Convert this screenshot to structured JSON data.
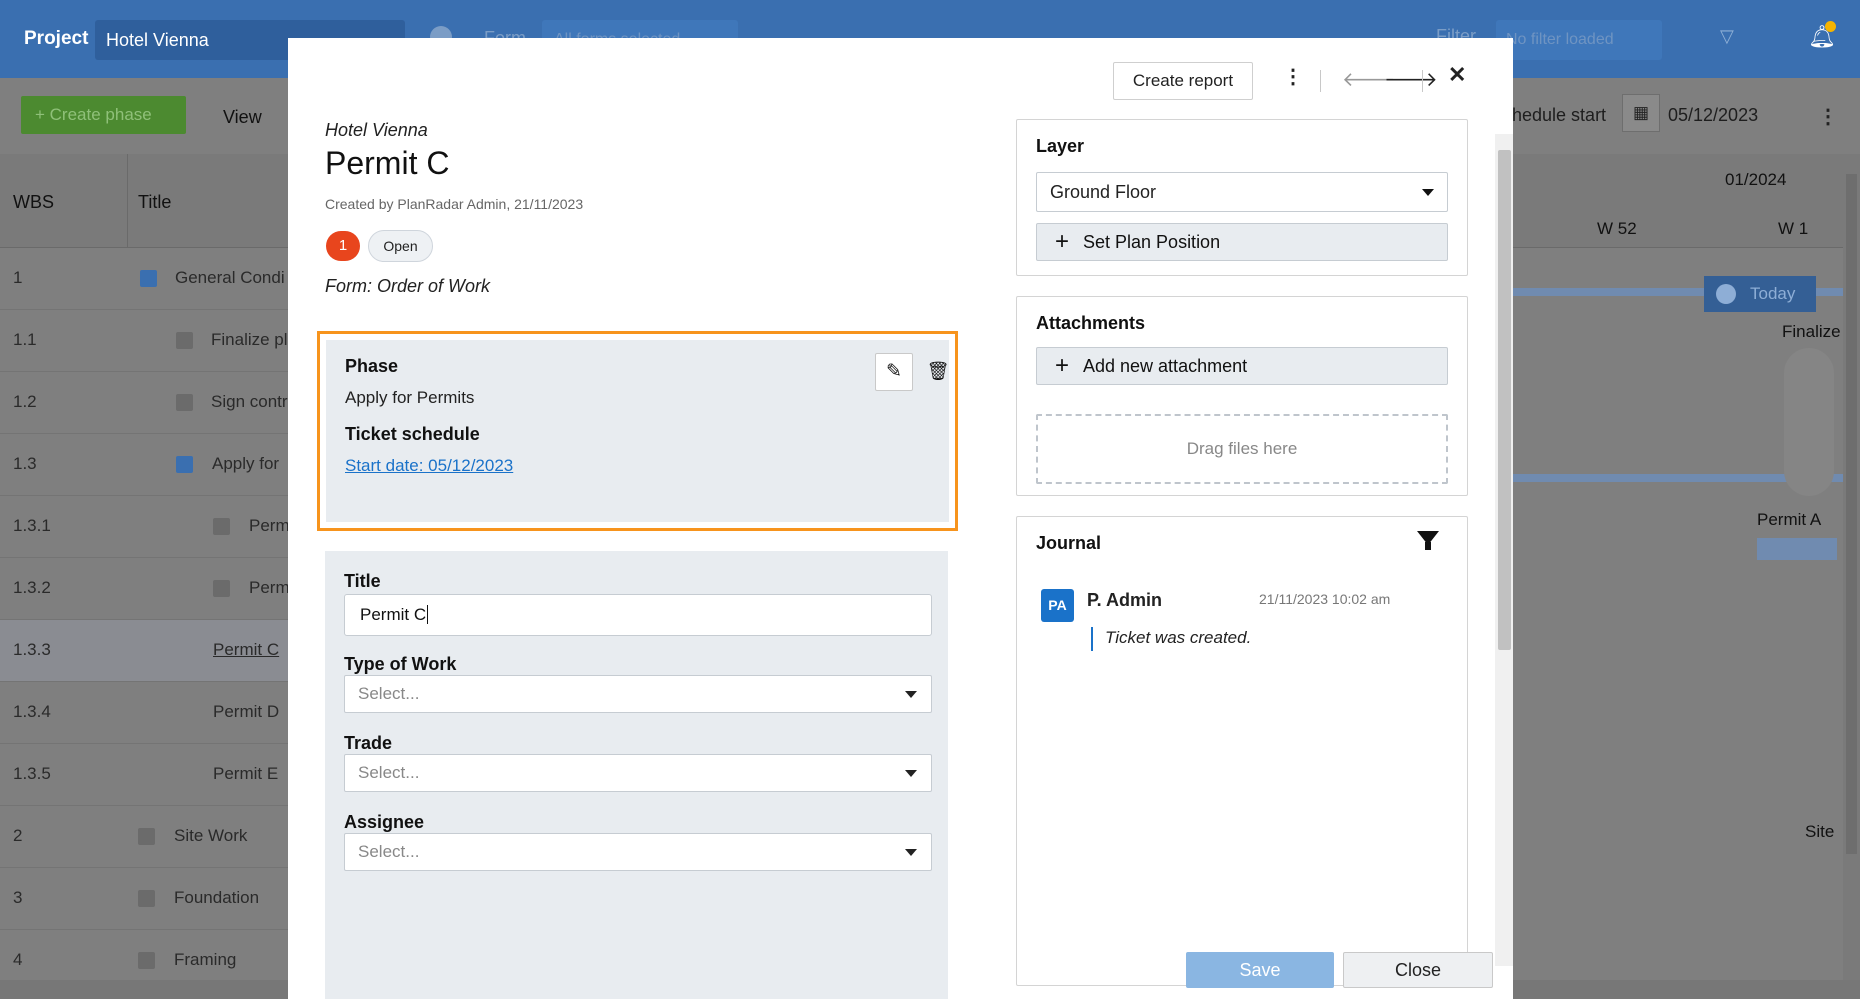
{
  "background": {
    "topbar": {
      "project_label": "Project",
      "project_value": "Hotel Vienna",
      "form_label": "Form",
      "form_value": "All forms selected",
      "filter_label": "Filter",
      "filter_value": "No filter loaded"
    },
    "toolbar": {
      "create_phase": "Create phase",
      "view_label": "View",
      "schedule_label": "hedule start",
      "schedule_date": "05/12/2023"
    },
    "grid": {
      "col_wbs": "WBS",
      "col_title": "Title",
      "month": "01/2024",
      "weeks": [
        "W 52",
        "W 1"
      ],
      "rows": [
        {
          "wbs": "1",
          "title": "General Condi"
        },
        {
          "wbs": "1.1",
          "title": "Finalize pl"
        },
        {
          "wbs": "1.2",
          "title": "Sign contr"
        },
        {
          "wbs": "1.3",
          "title": "Apply for"
        },
        {
          "wbs": "1.3.1",
          "title": "Perm"
        },
        {
          "wbs": "1.3.2",
          "title": "Perm"
        },
        {
          "wbs": "1.3.3",
          "title": "Permit C"
        },
        {
          "wbs": "1.3.4",
          "title": "Permit D"
        },
        {
          "wbs": "1.3.5",
          "title": "Permit E"
        },
        {
          "wbs": "2",
          "title": "Site Work"
        },
        {
          "wbs": "3",
          "title": "Foundation"
        },
        {
          "wbs": "4",
          "title": "Framing"
        }
      ],
      "today_label": "Today",
      "timeline_labels": [
        "Finalize",
        "Permit A",
        "Site"
      ]
    }
  },
  "dialog": {
    "create_report": "Create report",
    "project_name": "Hotel Vienna",
    "title": "Permit C",
    "created_by": "Created by PlanRadar Admin, 21/11/2023",
    "badge_number": "1",
    "status": "Open",
    "form_line": "Form: Order of Work",
    "phase": {
      "label": "Phase",
      "value": "Apply for Permits",
      "schedule_label": "Ticket schedule",
      "start_date_link": "Start date: 05/12/2023"
    },
    "fields": {
      "title_label": "Title",
      "title_value": "Permit C",
      "type_of_work_label": "Type of Work",
      "type_of_work_placeholder": "Select...",
      "trade_label": "Trade",
      "trade_placeholder": "Select...",
      "assignee_label": "Assignee",
      "assignee_placeholder": "Select..."
    },
    "layer": {
      "label": "Layer",
      "value": "Ground Floor",
      "set_plan_position": "Set Plan Position"
    },
    "attachments": {
      "label": "Attachments",
      "add_new": "Add new attachment",
      "drop_text": "Drag files here"
    },
    "journal": {
      "label": "Journal",
      "entries": [
        {
          "initials": "PA",
          "author": "P. Admin",
          "time": "21/11/2023 10:02 am",
          "message": "Ticket was created."
        }
      ]
    },
    "save": "Save",
    "close": "Close"
  },
  "colors": {
    "highlight_border": "#f7941d",
    "link": "#1a72c9",
    "status_badge": "#e8451d",
    "save_button": "#8ab6e2",
    "topbar": "#3a6fb0"
  }
}
